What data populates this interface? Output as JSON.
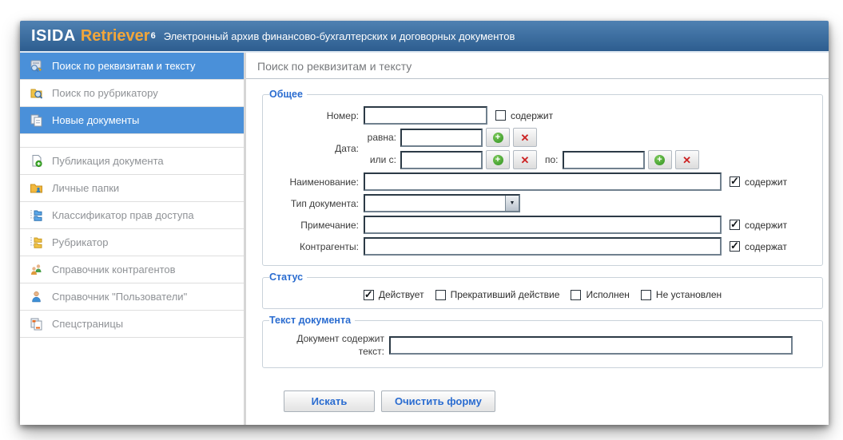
{
  "header": {
    "brand_isida": "ISIDA",
    "brand_retriever": "Retriever",
    "brand_sup": "6",
    "subtitle": "Электронный архив финансово-бухгалтерских и договорных документов"
  },
  "sidebar": {
    "items": [
      {
        "label": "Поиск по реквизитам и тексту",
        "icon": "search-text-icon",
        "selected": true
      },
      {
        "label": "Поиск по рубрикатору",
        "icon": "search-rubricator-icon",
        "selected": false
      },
      {
        "label": "Новые документы",
        "icon": "new-documents-icon",
        "selected": true
      },
      {
        "label": "Публикация документа",
        "icon": "publish-document-icon",
        "selected": false
      },
      {
        "label": "Личные папки",
        "icon": "personal-folders-icon",
        "selected": false
      },
      {
        "label": "Классификатор прав доступа",
        "icon": "access-rights-icon",
        "selected": false
      },
      {
        "label": "Рубрикатор",
        "icon": "rubricator-icon",
        "selected": false
      },
      {
        "label": "Справочник контрагентов",
        "icon": "contractors-icon",
        "selected": false
      },
      {
        "label": "Справочник \"Пользователи\"",
        "icon": "users-icon",
        "selected": false
      },
      {
        "label": "Спецстраницы",
        "icon": "special-pages-icon",
        "selected": false
      }
    ]
  },
  "main": {
    "title": "Поиск по реквизитам и тексту",
    "sections": {
      "general": {
        "legend": "Общее",
        "number_label": "Номер:",
        "number_value": "",
        "number_contains": {
          "label": "содержит",
          "checked": false
        },
        "date_label": "Дата:",
        "date_equals_label": "равна:",
        "date_equals_value": "",
        "date_from_label": "или с:",
        "date_from_value": "",
        "date_to_label": "по:",
        "date_to_value": "",
        "name_label": "Наименование:",
        "name_value": "",
        "name_contains": {
          "label": "содержит",
          "checked": true
        },
        "doctype_label": "Тип документа:",
        "doctype_value": "",
        "note_label": "Примечание:",
        "note_value": "",
        "note_contains": {
          "label": "содержит",
          "checked": true
        },
        "contractors_label": "Контрагенты:",
        "contractors_value": "",
        "contractors_contains": {
          "label": "содержат",
          "checked": true
        }
      },
      "status": {
        "legend": "Статус",
        "options": [
          {
            "label": "Действует",
            "checked": true
          },
          {
            "label": "Прекративший действие",
            "checked": false
          },
          {
            "label": "Исполнен",
            "checked": false
          },
          {
            "label": "Не установлен",
            "checked": false
          }
        ]
      },
      "text": {
        "legend": "Текст документа",
        "label": "Документ содержит текст:",
        "value": ""
      }
    },
    "buttons": {
      "search": "Искать",
      "clear": "Очистить форму"
    }
  },
  "icons": {
    "add_icon": "+",
    "remove_icon": "✕",
    "dropdown_arrow": "▼"
  },
  "colors": {
    "header_top": "#4f81b2",
    "header_bottom": "#2d5d8f",
    "brand_accent": "#f2a63a",
    "selected_item": "#4a90d9",
    "legend_blue": "#2a6cd0",
    "add_green": "#2f9220",
    "remove_red": "#cc2222"
  }
}
